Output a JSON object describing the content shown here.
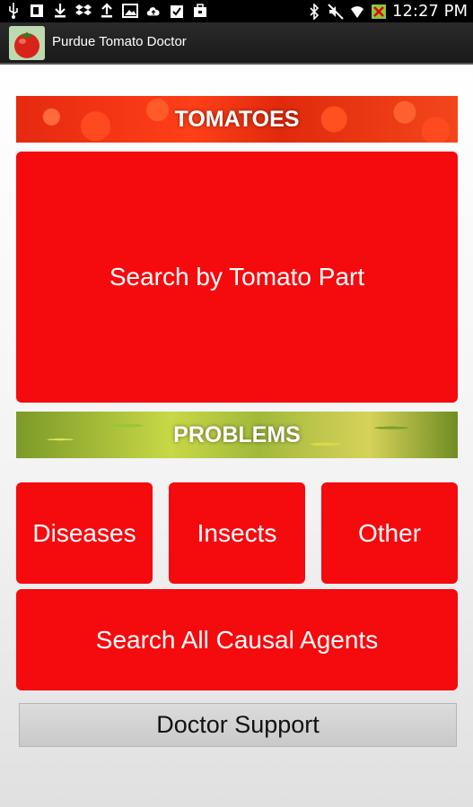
{
  "status_bar": {
    "time": "12:27 PM",
    "left_icons": [
      "usb-icon",
      "notification-icon",
      "download-icon",
      "dropbox-icon",
      "upload-icon",
      "image-icon",
      "cloud-upload-icon",
      "check-clipboard-icon",
      "briefcase-icon"
    ],
    "right_icons": [
      "bluetooth-icon",
      "mute-icon",
      "wifi-icon",
      "signal-icon"
    ]
  },
  "action_bar": {
    "title": "Purdue Tomato Doctor",
    "app_icon": "tomato-icon"
  },
  "sections": {
    "tomatoes_title": "TOMATOES",
    "problems_title": "PROBLEMS"
  },
  "buttons": {
    "search_by_part": "Search by Tomato Part",
    "diseases": "Diseases",
    "insects": "Insects",
    "other": "Other",
    "search_all": "Search All Causal Agents",
    "doctor_support": "Doctor Support"
  },
  "colors": {
    "button_red": "#f50a0e",
    "status_bar": "#000000",
    "action_bar": "#1f1f1f",
    "support_gray": "#d0d0d0"
  }
}
